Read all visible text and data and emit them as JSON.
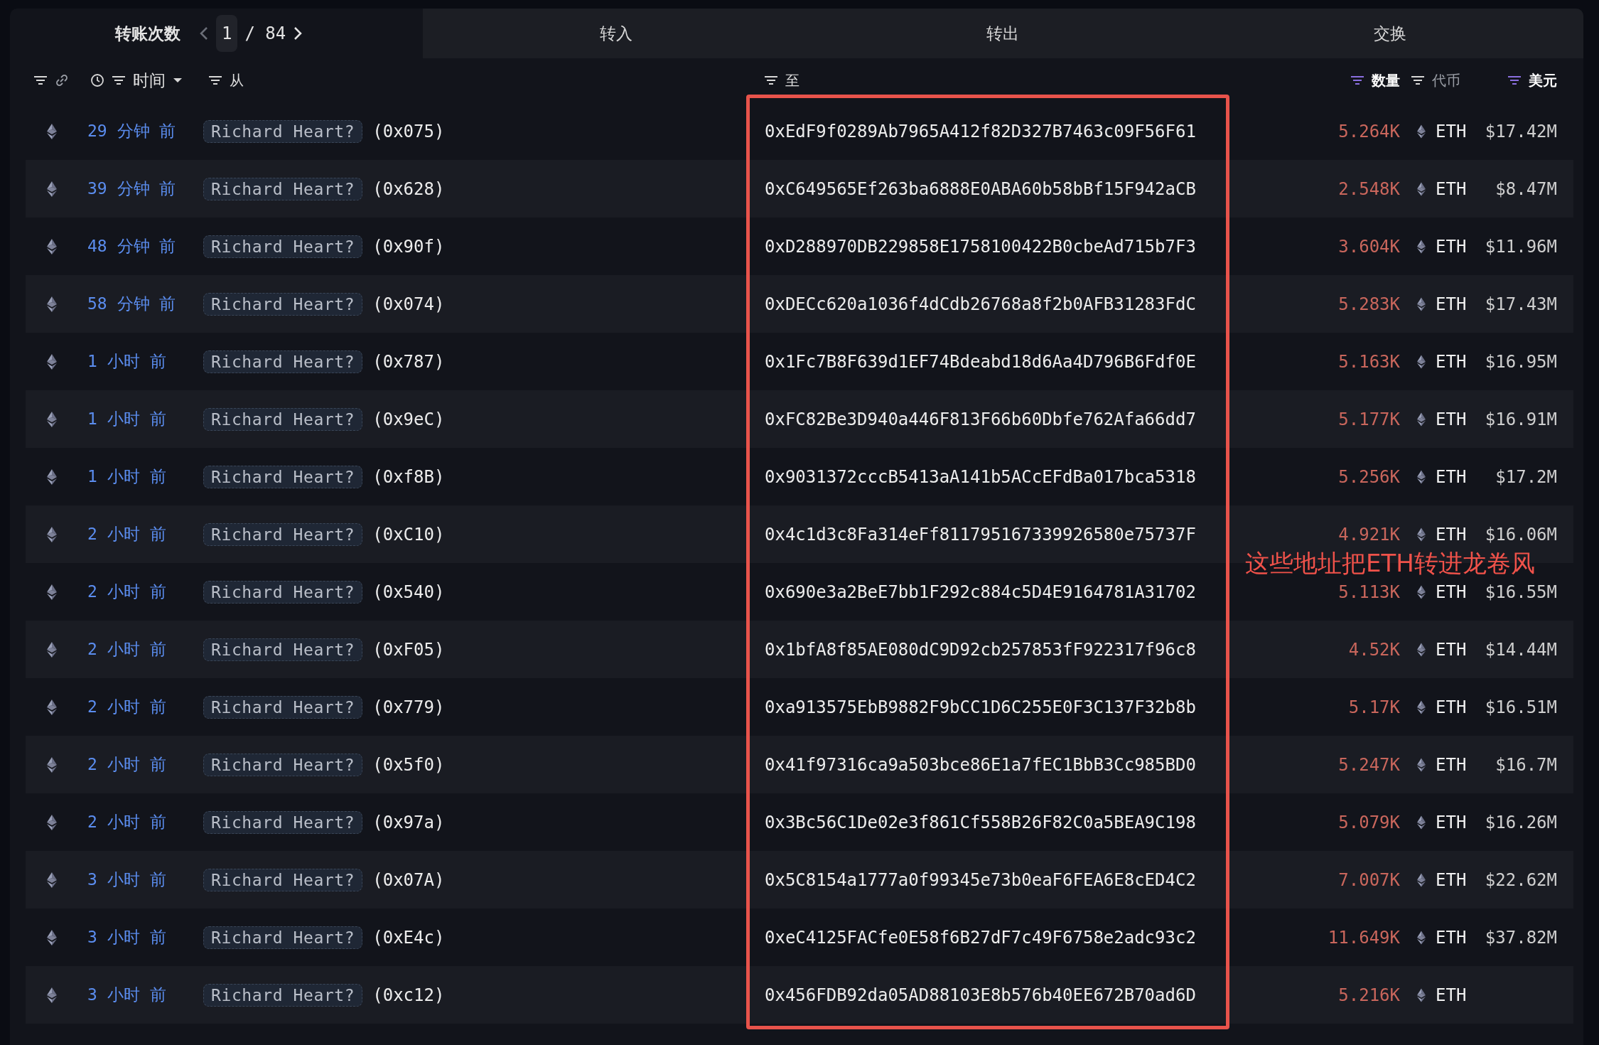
{
  "pager": {
    "label": "转账次数",
    "page": "1",
    "total": "/ 84"
  },
  "tabs": [
    {
      "label": "转入",
      "selected": false
    },
    {
      "label": "转出",
      "selected": false
    },
    {
      "label": "交换",
      "selected": false
    }
  ],
  "columns": [
    {
      "kind": "icons",
      "active": false
    },
    {
      "kind": "time",
      "label": "时间",
      "active": false
    },
    {
      "kind": "from",
      "label": "从",
      "active": false
    },
    {
      "kind": "to",
      "label": "至",
      "active": false
    },
    {
      "kind": "amount",
      "label": "数量",
      "active": true
    },
    {
      "kind": "token",
      "label": "代币",
      "active": false
    },
    {
      "kind": "usd",
      "label": "美元",
      "active": true
    }
  ],
  "rows": [
    {
      "time": "29 分钟 前",
      "entity": "Richard Heart?",
      "from": "(0x075)",
      "to": "0xEdF9f0289Ab7965A412f82D327B7463c09F56F61",
      "amount": "5.264K",
      "token": "ETH",
      "usd": "$17.42M"
    },
    {
      "time": "39 分钟 前",
      "entity": "Richard Heart?",
      "from": "(0x628)",
      "to": "0xC649565Ef263ba6888E0ABA60b58bBf15F942aCB",
      "amount": "2.548K",
      "token": "ETH",
      "usd": "$8.47M"
    },
    {
      "time": "48 分钟 前",
      "entity": "Richard Heart?",
      "from": "(0x90f)",
      "to": "0xD288970DB229858E1758100422B0cbeAd715b7F3",
      "amount": "3.604K",
      "token": "ETH",
      "usd": "$11.96M"
    },
    {
      "time": "58 分钟 前",
      "entity": "Richard Heart?",
      "from": "(0x074)",
      "to": "0xDECc620a1036f4dCdb26768a8f2b0AFB31283FdC",
      "amount": "5.283K",
      "token": "ETH",
      "usd": "$17.43M"
    },
    {
      "time": "1 小时 前",
      "entity": "Richard Heart?",
      "from": "(0x787)",
      "to": "0x1Fc7B8F639d1EF74Bdeabd18d6Aa4D796B6Fdf0E",
      "amount": "5.163K",
      "token": "ETH",
      "usd": "$16.95M"
    },
    {
      "time": "1 小时 前",
      "entity": "Richard Heart?",
      "from": "(0x9eC)",
      "to": "0xFC82Be3D940a446F813F66b60Dbfe762Afa66dd7",
      "amount": "5.177K",
      "token": "ETH",
      "usd": "$16.91M"
    },
    {
      "time": "1 小时 前",
      "entity": "Richard Heart?",
      "from": "(0xf8B)",
      "to": "0x9031372cccB5413aA141b5ACcEFdBa017bca5318",
      "amount": "5.256K",
      "token": "ETH",
      "usd": "$17.2M"
    },
    {
      "time": "2 小时 前",
      "entity": "Richard Heart?",
      "from": "(0xC10)",
      "to": "0x4c1d3c8Fa314eFf811795167339926580e75737F",
      "amount": "4.921K",
      "token": "ETH",
      "usd": "$16.06M"
    },
    {
      "time": "2 小时 前",
      "entity": "Richard Heart?",
      "from": "(0x540)",
      "to": "0x690e3a2BeE7bb1F292c884c5D4E9164781A31702",
      "amount": "5.113K",
      "token": "ETH",
      "usd": "$16.55M"
    },
    {
      "time": "2 小时 前",
      "entity": "Richard Heart?",
      "from": "(0xF05)",
      "to": "0x1bfA8f85AE080dC9D92cb257853fF922317f96c8",
      "amount": "4.52K",
      "token": "ETH",
      "usd": "$14.44M"
    },
    {
      "time": "2 小时 前",
      "entity": "Richard Heart?",
      "from": "(0x779)",
      "to": "0xa913575EbB9882F9bCC1D6C255E0F3C137F32b8b",
      "amount": "5.17K",
      "token": "ETH",
      "usd": "$16.51M"
    },
    {
      "time": "2 小时 前",
      "entity": "Richard Heart?",
      "from": "(0x5f0)",
      "to": "0x41f97316ca9a503bce86E1a7fEC1BbB3Cc985BD0",
      "amount": "5.247K",
      "token": "ETH",
      "usd": "$16.7M"
    },
    {
      "time": "2 小时 前",
      "entity": "Richard Heart?",
      "from": "(0x97a)",
      "to": "0x3Bc56C1De02e3f861Cf558B26F82C0a5BEA9C198",
      "amount": "5.079K",
      "token": "ETH",
      "usd": "$16.26M"
    },
    {
      "time": "3 小时 前",
      "entity": "Richard Heart?",
      "from": "(0x07A)",
      "to": "0x5C8154a1777a0f99345e73b0eaF6FEA6E8cED4C2",
      "amount": "7.007K",
      "token": "ETH",
      "usd": "$22.62M"
    },
    {
      "time": "3 小时 前",
      "entity": "Richard Heart?",
      "from": "(0xE4c)",
      "to": "0xeC4125FACfe0E58f6B27dF7c49F6758e2adc93c2",
      "amount": "11.649K",
      "token": "ETH",
      "usd": "$37.82M"
    },
    {
      "time": "3 小时 前",
      "entity": "Richard Heart?",
      "from": "(0xc12)",
      "to": "0x456FDB92da05AD88103E8b576b40EE672B70ad6D",
      "amount": "5.216K",
      "token": "ETH"
    }
  ],
  "highlight": {
    "note": "这些地址把ETH转进龙卷风"
  }
}
